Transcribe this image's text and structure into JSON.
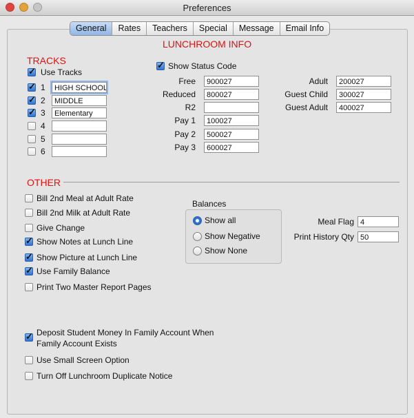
{
  "window": {
    "title": "Preferences"
  },
  "tabs": [
    "General",
    "Rates",
    "Teachers",
    "Special",
    "Message",
    "Email Info"
  ],
  "lunchroom_info": {
    "heading": "LUNCHROOM INFO"
  },
  "tracks": {
    "heading": "TRACKS",
    "use_tracks_label": "Use Tracks",
    "items": [
      {
        "num": "1",
        "value": "HIGH SCHOOL",
        "checked": true
      },
      {
        "num": "2",
        "value": "MIDDLE",
        "checked": true
      },
      {
        "num": "3",
        "value": "Elementary",
        "checked": true
      },
      {
        "num": "4",
        "value": "",
        "checked": false
      },
      {
        "num": "5",
        "value": "",
        "checked": false
      },
      {
        "num": "6",
        "value": "",
        "checked": false
      }
    ]
  },
  "status_code": {
    "label": "Show Status Code"
  },
  "codes_left": [
    {
      "label": "Free",
      "value": "900027"
    },
    {
      "label": "Reduced",
      "value": "800027"
    },
    {
      "label": "R2",
      "value": ""
    },
    {
      "label": "Pay 1",
      "value": "100027"
    },
    {
      "label": "Pay 2",
      "value": "500027"
    },
    {
      "label": "Pay 3",
      "value": "600027"
    }
  ],
  "codes_right": [
    {
      "label": "Adult",
      "value": "200027"
    },
    {
      "label": "Guest Child",
      "value": "300027"
    },
    {
      "label": "Guest Adult",
      "value": "400027"
    }
  ],
  "other": {
    "heading": "OTHER",
    "options": [
      {
        "label": "Bill 2nd Meal at Adult Rate",
        "checked": false
      },
      {
        "label": "Bill 2nd Milk at  Adult Rate",
        "checked": false
      },
      {
        "label": "Give Change",
        "checked": false
      },
      {
        "label": "Show Notes at Lunch Line",
        "checked": true
      },
      {
        "label": "Show Picture at Lunch Line",
        "checked": true
      },
      {
        "label": "Use Family Balance",
        "checked": true
      },
      {
        "label": "Print Two Master Report Pages",
        "checked": false
      }
    ],
    "bottom_options": [
      {
        "label_line1": "Deposit Student Money In Family Account When",
        "label_line2": "Family Account Exists",
        "checked": true
      },
      {
        "label_line1": "Use Small Screen Option",
        "checked": false
      },
      {
        "label_line1": "Turn Off Lunchroom Duplicate Notice",
        "checked": false
      }
    ]
  },
  "balances": {
    "title": "Balances",
    "options": [
      "Show all",
      "Show Negative",
      "Show None"
    ],
    "selected": "Show all"
  },
  "meal_flag": {
    "label": "Meal Flag",
    "value": "4"
  },
  "print_history_qty": {
    "label": "Print History Qty",
    "value": "50"
  }
}
